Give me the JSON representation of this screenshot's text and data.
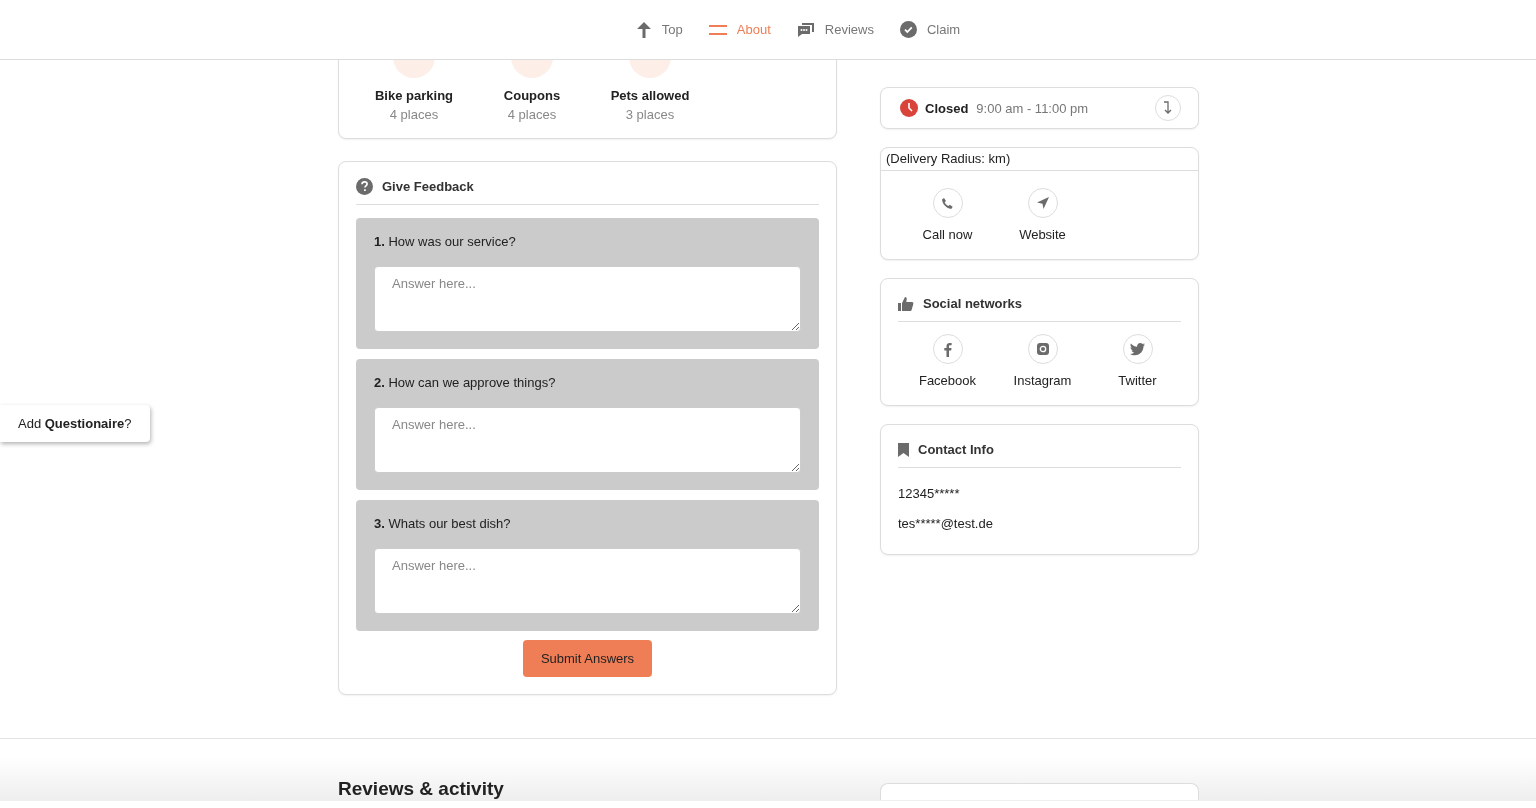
{
  "nav": {
    "tabs": [
      {
        "kind": "top",
        "label": "Top",
        "selected": false
      },
      {
        "kind": "about",
        "label": "About",
        "selected": true
      },
      {
        "kind": "reviews",
        "label": "Reviews",
        "selected": false
      },
      {
        "kind": "claim",
        "label": "Claim",
        "selected": false
      }
    ]
  },
  "amenities": [
    {
      "name": "Bike parking",
      "count": "4 places"
    },
    {
      "name": "Coupons",
      "count": "4 places"
    },
    {
      "name": "Pets allowed",
      "count": "3 places"
    }
  ],
  "feedback": {
    "title": "Give Feedback",
    "questions": [
      {
        "text": "**1.** How was our service?",
        "placeholder": "Answer here..."
      },
      {
        "text": "**2.** How can we approve things?",
        "placeholder": "Answer here..."
      },
      {
        "text": "**3.** Whats our best dish?",
        "placeholder": "Answer here..."
      }
    ],
    "submit": "Submit Answers"
  },
  "questionnaire_tab": "Add **Questionaire**?",
  "hours": {
    "status": "Closed",
    "times": "9:00 am - 11:00 pm"
  },
  "delivery": {
    "radius": "(Delivery Radius: km)",
    "actions": [
      {
        "kind": "phone",
        "label": "Call now"
      },
      {
        "kind": "website",
        "label": "Website"
      }
    ]
  },
  "social": {
    "title": "Social networks",
    "links": [
      {
        "kind": "facebook",
        "label": "Facebook"
      },
      {
        "kind": "instagram",
        "label": "Instagram"
      },
      {
        "kind": "twitter",
        "label": "Twitter"
      }
    ]
  },
  "contact": {
    "title": "Contact Info",
    "phone": "12345*****",
    "email": "tes*****@test.de"
  },
  "reviews_section": {
    "title": "Reviews & activity"
  }
}
